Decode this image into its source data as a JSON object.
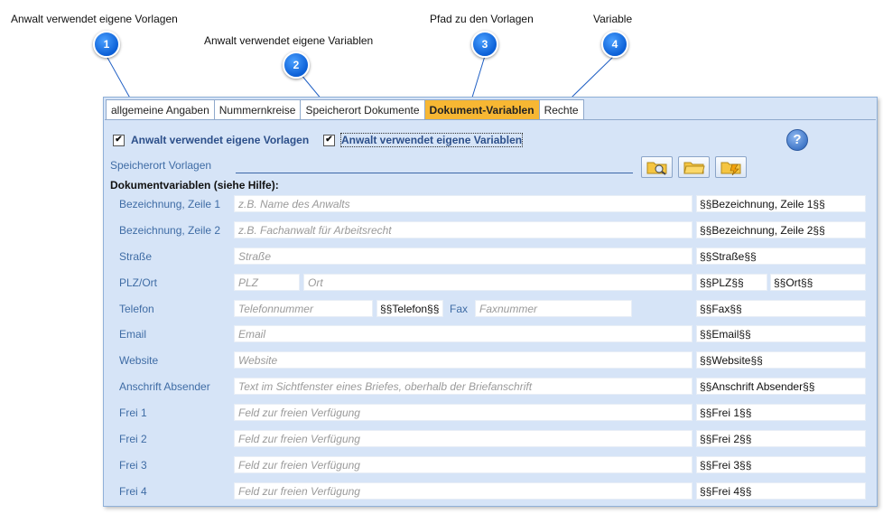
{
  "callouts": [
    {
      "num": "1",
      "text": "Anwalt verwendet eigene Vorlagen"
    },
    {
      "num": "2",
      "text": "Anwalt verwendet eigene Variablen"
    },
    {
      "num": "3",
      "text": "Pfad zu den Vorlagen"
    },
    {
      "num": "4",
      "text": "Variable"
    }
  ],
  "tabs": [
    "allgemeine Angaben",
    "Nummernkreise",
    "Speicherort Dokumente",
    "Dokument-Variablen",
    "Rechte"
  ],
  "active_tab": "Dokument-Variablen",
  "checkboxes": {
    "own_templates": {
      "label": "Anwalt verwendet eigene Vorlagen",
      "checked": true
    },
    "own_variables": {
      "label": "Anwalt verwendet eigene Variablen",
      "checked": true
    }
  },
  "help_icon": "?",
  "template_path": {
    "label": "Speicherort Vorlagen",
    "value": ""
  },
  "section_title": "Dokumentvariablen (siehe Hilfe):",
  "rows": {
    "bez1": {
      "label": "Bezeichnung, Zeile 1",
      "placeholder": "z.B. Name des Anwalts",
      "var": "§§Bezeichnung, Zeile 1§§"
    },
    "bez2": {
      "label": "Bezeichnung, Zeile 2",
      "placeholder": "z.B. Fachanwalt für Arbeitsrecht",
      "var": "§§Bezeichnung, Zeile 2§§"
    },
    "strasse": {
      "label": "Straße",
      "placeholder": "Straße",
      "var": "§§Straße§§"
    },
    "plzort": {
      "label": "PLZ/Ort",
      "plz_placeholder": "PLZ",
      "ort_placeholder": "Ort",
      "var_plz": "§§PLZ§§",
      "var_ort": "§§Ort§§"
    },
    "telefon": {
      "label": "Telefon",
      "placeholder": "Telefonnummer",
      "var": "§§Telefon§§",
      "fax_label": "Fax",
      "fax_placeholder": "Faxnummer",
      "fax_var": "§§Fax§§"
    },
    "email": {
      "label": "Email",
      "placeholder": "Email",
      "var": "§§Email§§"
    },
    "website": {
      "label": "Website",
      "placeholder": "Website",
      "var": "§§Website§§"
    },
    "anschrift": {
      "label": "Anschrift Absender",
      "placeholder": "Text im Sichtfenster eines Briefes, oberhalb der Briefanschrift",
      "var": "§§Anschrift Absender§§"
    },
    "frei1": {
      "label": "Frei 1",
      "placeholder": "Feld zur freien Verfügung",
      "var": "§§Frei 1§§"
    },
    "frei2": {
      "label": "Frei 2",
      "placeholder": "Feld zur freien Verfügung",
      "var": "§§Frei 2§§"
    },
    "frei3": {
      "label": "Frei 3",
      "placeholder": "Feld zur freien Verfügung",
      "var": "§§Frei 3§§"
    },
    "frei4": {
      "label": "Frei 4",
      "placeholder": "Feld zur freien Verfügung",
      "var": "§§Frei 4§§"
    }
  },
  "icons": {
    "browse": "folder-search-icon",
    "open": "folder-open-icon",
    "new": "folder-new-icon"
  },
  "colors": {
    "active_tab": "#f7b733",
    "panel": "#d6e4f7",
    "badge": "#0b5fd6",
    "label": "#3f6ca5"
  }
}
